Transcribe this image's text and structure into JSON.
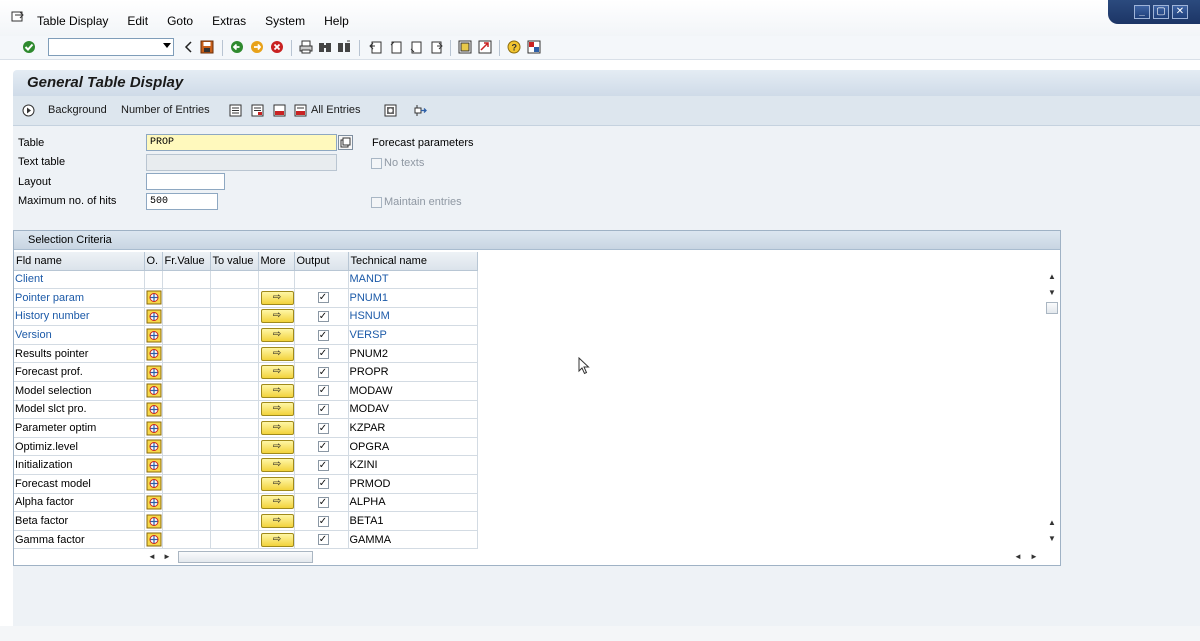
{
  "menubar": {
    "items": [
      {
        "label": "Table Display"
      },
      {
        "label": "Edit"
      },
      {
        "label": "Goto"
      },
      {
        "label": "Extras"
      },
      {
        "label": "System"
      },
      {
        "label": "Help"
      }
    ],
    "window_controls": [
      "_",
      "▢",
      "✕"
    ]
  },
  "toolbar": {
    "command_field_value": ""
  },
  "screen": {
    "title": "General Table Display",
    "app_toolbar": {
      "background_label": "Background",
      "number_of_entries_label": "Number of Entries",
      "all_entries_label": "All Entries"
    }
  },
  "form": {
    "table_label": "Table",
    "table_value": "PROP",
    "text_table_label": "Text table",
    "text_table_value": "",
    "layout_label": "Layout",
    "layout_value": "",
    "max_hits_label": "Maximum no. of hits",
    "max_hits_value": "500",
    "forecast_params_label": "Forecast parameters",
    "no_texts_label": "No texts",
    "maintain_entries_label": "Maintain entries"
  },
  "selection": {
    "title": "Selection Criteria",
    "columns": [
      "Fld name",
      "O.",
      "Fr.Value",
      "To value",
      "More",
      "Output",
      "Technical name"
    ],
    "rows": [
      {
        "fld": "Client",
        "tech": "MANDT",
        "key": true,
        "has_option": false,
        "output": false
      },
      {
        "fld": "Pointer param",
        "tech": "PNUM1",
        "key": true,
        "has_option": true,
        "output": true
      },
      {
        "fld": "History number",
        "tech": "HSNUM",
        "key": true,
        "has_option": true,
        "output": true
      },
      {
        "fld": "Version",
        "tech": "VERSP",
        "key": true,
        "has_option": true,
        "output": true
      },
      {
        "fld": "Results pointer",
        "tech": "PNUM2",
        "key": false,
        "has_option": true,
        "output": true
      },
      {
        "fld": "Forecast prof.",
        "tech": "PROPR",
        "key": false,
        "has_option": true,
        "output": true
      },
      {
        "fld": "Model selection",
        "tech": "MODAW",
        "key": false,
        "has_option": true,
        "output": true
      },
      {
        "fld": "Model slct pro.",
        "tech": "MODAV",
        "key": false,
        "has_option": true,
        "output": true
      },
      {
        "fld": "Parameter optim",
        "tech": "KZPAR",
        "key": false,
        "has_option": true,
        "output": true
      },
      {
        "fld": "Optimiz.level",
        "tech": "OPGRA",
        "key": false,
        "has_option": true,
        "output": true
      },
      {
        "fld": "Initialization",
        "tech": "KZINI",
        "key": false,
        "has_option": true,
        "output": true
      },
      {
        "fld": "Forecast model",
        "tech": "PRMOD",
        "key": false,
        "has_option": true,
        "output": true
      },
      {
        "fld": "Alpha factor",
        "tech": "ALPHA",
        "key": false,
        "has_option": true,
        "output": true
      },
      {
        "fld": "Beta factor",
        "tech": "BETA1",
        "key": false,
        "has_option": true,
        "output": true
      },
      {
        "fld": "Gamma factor",
        "tech": "GAMMA",
        "key": false,
        "has_option": true,
        "output": true
      }
    ],
    "more_glyph": "⇨",
    "check_glyph": "✓"
  },
  "colors": {
    "key_field": "#1c5aa8",
    "required_field_bg": "#fff9bd",
    "header_gradient_top": "#e4ecf4"
  }
}
